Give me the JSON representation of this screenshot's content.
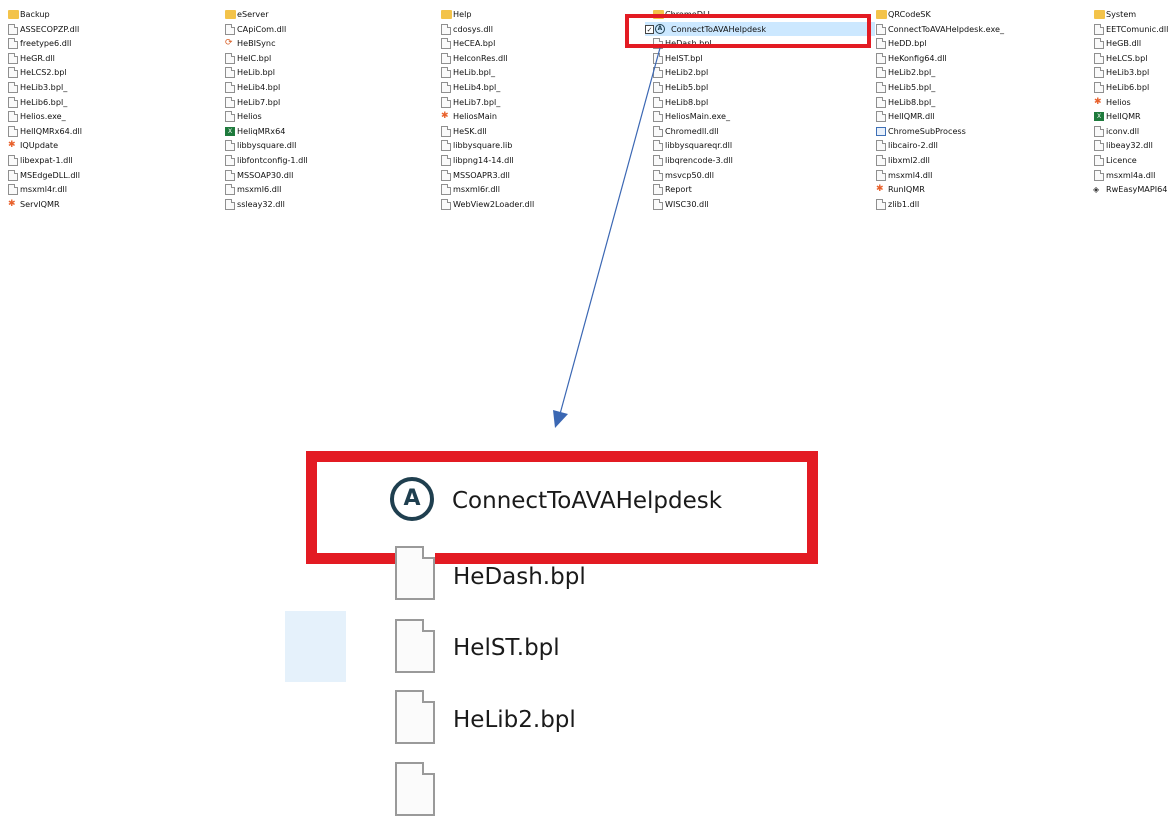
{
  "columns": [
    {
      "items": [
        {
          "name": "Backup",
          "icon": "folder-icon"
        },
        {
          "name": "ASSECOPZP.dll",
          "icon": "file-icon"
        },
        {
          "name": "freetype6.dll",
          "icon": "file-icon"
        },
        {
          "name": "HeGR.dll",
          "icon": "file-icon"
        },
        {
          "name": "HeLCS2.bpl",
          "icon": "file-icon"
        },
        {
          "name": "HeLib3.bpl_",
          "icon": "file-icon"
        },
        {
          "name": "HeLib6.bpl_",
          "icon": "file-icon"
        },
        {
          "name": "Helios.exe_",
          "icon": "file-icon"
        },
        {
          "name": "HelIQMRx64.dll",
          "icon": "file-icon"
        },
        {
          "name": "IQUpdate",
          "icon": "app-icon"
        },
        {
          "name": "libexpat-1.dll",
          "icon": "file-icon"
        },
        {
          "name": "MSEdgeDLL.dll",
          "icon": "file-icon"
        },
        {
          "name": "msxml4r.dll",
          "icon": "file-icon"
        },
        {
          "name": "ServIQMR",
          "icon": "app-icon"
        }
      ]
    },
    {
      "items": [
        {
          "name": "eServer",
          "icon": "folder-icon"
        },
        {
          "name": "CApiCom.dll",
          "icon": "file-icon"
        },
        {
          "name": "HeBISync",
          "icon": "sync-icon"
        },
        {
          "name": "HeIC.bpl",
          "icon": "file-icon"
        },
        {
          "name": "HeLib.bpl",
          "icon": "file-icon"
        },
        {
          "name": "HeLib4.bpl",
          "icon": "file-icon"
        },
        {
          "name": "HeLib7.bpl",
          "icon": "file-icon"
        },
        {
          "name": "Helios",
          "icon": "file-icon"
        },
        {
          "name": "HeliqMRx64",
          "icon": "exe-icon"
        },
        {
          "name": "libbysquare.dll",
          "icon": "file-icon"
        },
        {
          "name": "libfontconfig-1.dll",
          "icon": "file-icon"
        },
        {
          "name": "MSSOAP30.dll",
          "icon": "file-icon"
        },
        {
          "name": "msxml6.dll",
          "icon": "file-icon"
        },
        {
          "name": "ssleay32.dll",
          "icon": "file-icon"
        }
      ]
    },
    {
      "items": [
        {
          "name": "Help",
          "icon": "folder-icon"
        },
        {
          "name": "cdosys.dll",
          "icon": "file-icon"
        },
        {
          "name": "HeCEA.bpl",
          "icon": "file-icon"
        },
        {
          "name": "HeIconRes.dll",
          "icon": "file-icon"
        },
        {
          "name": "HeLib.bpl_",
          "icon": "file-icon"
        },
        {
          "name": "HeLib4.bpl_",
          "icon": "file-icon"
        },
        {
          "name": "HeLib7.bpl_",
          "icon": "file-icon"
        },
        {
          "name": "HeliosMain",
          "icon": "app-icon"
        },
        {
          "name": "HeSK.dll",
          "icon": "file-icon"
        },
        {
          "name": "libbysquare.lib",
          "icon": "file-icon"
        },
        {
          "name": "libpng14-14.dll",
          "icon": "file-icon"
        },
        {
          "name": "MSSOAPR3.dll",
          "icon": "file-icon"
        },
        {
          "name": "msxml6r.dll",
          "icon": "file-icon"
        },
        {
          "name": "WebView2Loader.dll",
          "icon": "file-icon"
        }
      ]
    },
    {
      "items": [
        {
          "name": "ChromeDLL",
          "icon": "folder-icon"
        },
        {
          "name": "ConnectToAVAHelpdesk",
          "icon": "ava-icon",
          "selected": true
        },
        {
          "name": "HeDash.bpl",
          "icon": "file-icon"
        },
        {
          "name": "HeIST.bpl",
          "icon": "file-icon"
        },
        {
          "name": "HeLib2.bpl",
          "icon": "file-icon"
        },
        {
          "name": "HeLib5.bpl",
          "icon": "file-icon"
        },
        {
          "name": "HeLib8.bpl",
          "icon": "file-icon"
        },
        {
          "name": "HeliosMain.exe_",
          "icon": "file-icon"
        },
        {
          "name": "Chromedll.dll",
          "icon": "file-icon"
        },
        {
          "name": "libbysquareqr.dll",
          "icon": "file-icon"
        },
        {
          "name": "libqrencode-3.dll",
          "icon": "file-icon"
        },
        {
          "name": "msvcp50.dll",
          "icon": "file-icon"
        },
        {
          "name": "Report",
          "icon": "file-icon"
        },
        {
          "name": "WISC30.dll",
          "icon": "file-icon"
        }
      ]
    },
    {
      "items": [
        {
          "name": "QRCodeSK",
          "icon": "folder-icon"
        },
        {
          "name": "ConnectToAVAHelpdesk.exe_",
          "icon": "file-icon"
        },
        {
          "name": "HeDD.bpl",
          "icon": "file-icon"
        },
        {
          "name": "HeKonfig64.dll",
          "icon": "file-icon"
        },
        {
          "name": "HeLib2.bpl_",
          "icon": "file-icon"
        },
        {
          "name": "HeLib5.bpl_",
          "icon": "file-icon"
        },
        {
          "name": "HeLib8.bpl_",
          "icon": "file-icon"
        },
        {
          "name": "HelIQMR.dll",
          "icon": "file-icon"
        },
        {
          "name": "ChromeSubProcess",
          "icon": "window-icon"
        },
        {
          "name": "libcairo-2.dll",
          "icon": "file-icon"
        },
        {
          "name": "libxml2.dll",
          "icon": "file-icon"
        },
        {
          "name": "msxml4.dll",
          "icon": "file-icon"
        },
        {
          "name": "RunIQMR",
          "icon": "app-icon"
        },
        {
          "name": "zlib1.dll",
          "icon": "file-icon"
        }
      ]
    },
    {
      "items": [
        {
          "name": "System",
          "icon": "folder-icon"
        },
        {
          "name": "EETComunic.dll",
          "icon": "file-icon"
        },
        {
          "name": "HeGB.dll",
          "icon": "file-icon"
        },
        {
          "name": "HeLCS.bpl",
          "icon": "file-icon"
        },
        {
          "name": "HeLib3.bpl",
          "icon": "file-icon"
        },
        {
          "name": "HeLib6.bpl",
          "icon": "file-icon"
        },
        {
          "name": "Helios",
          "icon": "app-icon"
        },
        {
          "name": "HelIQMR",
          "icon": "exe-icon"
        },
        {
          "name": "iconv.dll",
          "icon": "file-icon"
        },
        {
          "name": "libeay32.dll",
          "icon": "file-icon"
        },
        {
          "name": "Licence",
          "icon": "file-icon"
        },
        {
          "name": "msxml4a.dll",
          "icon": "file-icon"
        },
        {
          "name": "RwEasyMAPI64",
          "icon": "device-icon"
        }
      ]
    }
  ],
  "zoom": {
    "highlight_label": "ConnectToAVAHelpdesk",
    "highlight_icon_letter": "A",
    "items": [
      "HeDash.bpl",
      "HelST.bpl",
      "HeLib2.bpl"
    ]
  },
  "colors": {
    "highlight": "#e31b23",
    "arrow": "#3b67b3",
    "selection": "#cce8ff"
  }
}
